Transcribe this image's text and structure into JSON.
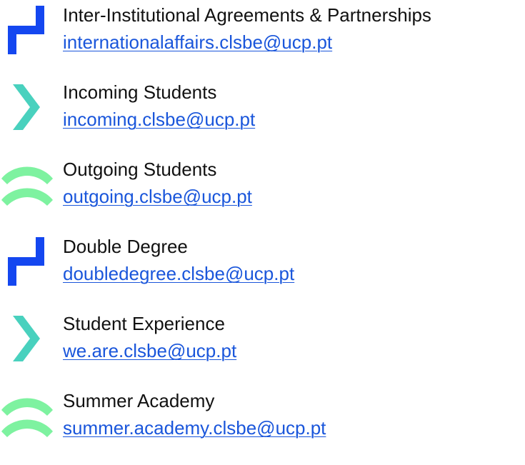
{
  "colors": {
    "blue_icon": "#1447f0",
    "teal_icon": "#49d1be",
    "green_icon": "#7ef2a0",
    "title_text": "#111111",
    "link_text": "#1a56db"
  },
  "contacts": [
    {
      "title": "Inter-Institutional Agreements & Partnerships",
      "email": "internationalaffairs.clsbe@ucp.pt",
      "icon": "blue-corner-icon"
    },
    {
      "title": "Incoming Students",
      "email": "incoming.clsbe@ucp.pt",
      "icon": "teal-chevron-icon"
    },
    {
      "title": "Outgoing Students",
      "email": "outgoing.clsbe@ucp.pt",
      "icon": "green-arc-icon"
    },
    {
      "title": "Double Degree",
      "email": "doubledegree.clsbe@ucp.pt",
      "icon": "blue-corner-icon"
    },
    {
      "title": "Student Experience",
      "email": "we.are.clsbe@ucp.pt",
      "icon": "teal-chevron-icon"
    },
    {
      "title": "Summer Academy",
      "email": "summer.academy.clsbe@ucp.pt",
      "icon": "green-arc-icon"
    }
  ]
}
